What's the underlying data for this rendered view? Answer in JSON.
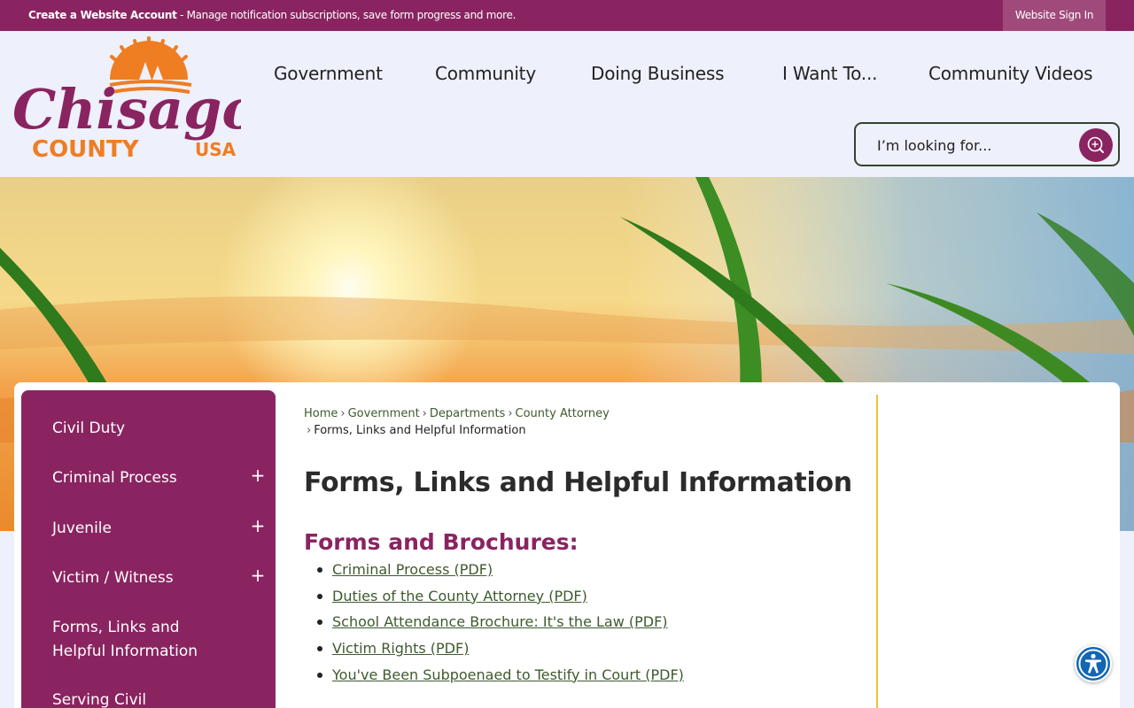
{
  "topbar": {
    "account_link": "Create a Website Account",
    "account_desc": " - Manage notification subscriptions, save form progress and more.",
    "signin": "Website Sign In"
  },
  "logo": {
    "word1": "Chisago",
    "word2": "COUNTY",
    "word3": "USA"
  },
  "nav": [
    "Government",
    "Community",
    "Doing Business",
    "I Want To...",
    "Community Videos"
  ],
  "search": {
    "placeholder": "I’m looking for..."
  },
  "sidebar": {
    "items": [
      {
        "label": "Civil Duty",
        "expandable": false
      },
      {
        "label": "Criminal Process",
        "expandable": true
      },
      {
        "label": "Juvenile",
        "expandable": true
      },
      {
        "label": "Victim / Witness",
        "expandable": true
      },
      {
        "label": "Forms, Links and Helpful Information",
        "expandable": false
      },
      {
        "label": "Serving Civil",
        "expandable": false
      }
    ],
    "plus_glyph": "+"
  },
  "breadcrumb": {
    "items": [
      "Home",
      "Government",
      "Departments",
      "County Attorney"
    ],
    "current": "Forms, Links and Helpful Information",
    "separator": "›"
  },
  "main": {
    "title": "Forms, Links and Helpful Information",
    "section_heading": "Forms and Brochures:",
    "documents": [
      "Criminal Process (PDF)",
      "Duties of the County Attorney (PDF)",
      "School Attendance Brochure: It's the Law (PDF)",
      "Victim Rights (PDF)",
      "You've Been Subpoenaed to Testify in Court (PDF)"
    ]
  },
  "colors": {
    "brand_plum": "#8a2461",
    "accent_orange": "#ef7d22",
    "link_green": "#3e5a2e",
    "divider_gold": "#f1c232",
    "accessibility_blue": "#1266b3"
  },
  "icons": {
    "search_button": "search-icon",
    "accessibility": "accessibility-icon",
    "expand": "plus-icon"
  }
}
